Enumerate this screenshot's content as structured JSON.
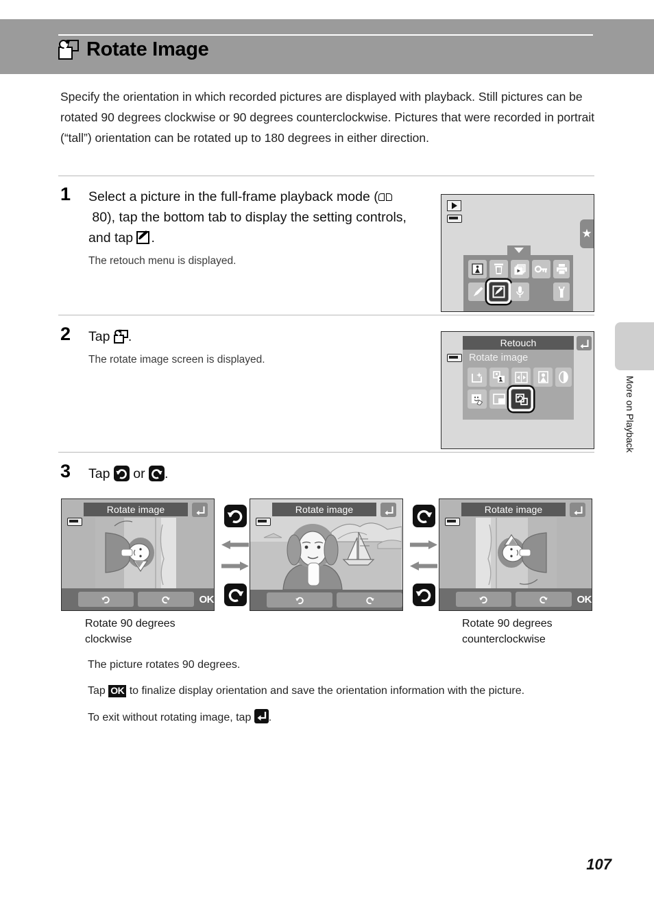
{
  "header": {
    "title": "Rotate Image",
    "icon": "rotate-image-icon"
  },
  "intro": "Specify the orientation in which recorded pictures are displayed with playback. Still pictures can be rotated 90 degrees clockwise or 90 degrees counterclockwise. Pictures that were recorded in portrait (“tall”) orientation can be rotated up to 180 degrees in either direction.",
  "steps": [
    {
      "number": "1",
      "head_part1": "Select a picture in the full-frame playback mode (",
      "head_page_ref": "80",
      "head_part2": "), tap the bottom tab to display the setting controls, and tap ",
      "head_part3": ".",
      "sub": "The retouch menu is displayed."
    },
    {
      "number": "2",
      "head_part1": "Tap ",
      "head_part3": ".",
      "sub": "The rotate image screen is displayed."
    },
    {
      "number": "3",
      "head_part1": "Tap ",
      "head_mid": " or ",
      "head_part3": "."
    }
  ],
  "screen1": {
    "status_play_icon": "playback-mode-icon",
    "battery_icon": "battery-icon",
    "favorites_tab_icon": "star-icon",
    "arrow_icon": "chevron-down-icon",
    "row1_keys": [
      {
        "name": "favorites-key",
        "icon": "person-in-box-icon"
      },
      {
        "name": "delete-key",
        "icon": "trash-icon"
      },
      {
        "name": "slideshow-key",
        "icon": "slideshow-icon"
      },
      {
        "name": "protect-key",
        "icon": "key-icon"
      },
      {
        "name": "print-order-key",
        "icon": "printer-icon"
      }
    ],
    "row2_keys": [
      {
        "name": "quick-edit-key",
        "icon": "pencil-icon"
      },
      {
        "name": "retouch-key",
        "icon": "retouch-pencil-box-icon",
        "selected": true
      },
      {
        "name": "voice-memo-key",
        "icon": "microphone-icon"
      },
      {
        "name": "setup-key",
        "icon": "wrench-icon"
      }
    ]
  },
  "screen2": {
    "title": "Retouch",
    "menu_label": "Rotate image",
    "back_icon": "back-arrow-icon",
    "battery_icon": "battery-icon",
    "row1_keys": [
      {
        "name": "quick-retouch-key",
        "icon": "sparkle-frame-icon"
      },
      {
        "name": "d-lighting-key",
        "icon": "d-lighting-icon"
      },
      {
        "name": "small-picture-key",
        "icon": "resize-icon"
      },
      {
        "name": "skin-softening-key",
        "icon": "portrait-icon"
      },
      {
        "name": "filter-effects-key",
        "icon": "half-circle-icon"
      }
    ],
    "row2_keys": [
      {
        "name": "paint-key",
        "icon": "paint-face-icon"
      },
      {
        "name": "crop-key",
        "icon": "crop-icon"
      },
      {
        "name": "rotate-image-key",
        "icon": "rotate-image-icon",
        "selected": true
      }
    ]
  },
  "screen3": {
    "title": "Rotate image",
    "back_icon": "back-arrow-icon",
    "battery_icon": "battery-icon",
    "clockwise_icon": "rotate-clockwise-icon",
    "counterclockwise_icon": "rotate-counterclockwise-icon",
    "ok_label": "OK",
    "left_caption": "Rotate 90 degrees clockwise",
    "right_caption": "Rotate 90 degrees counterclockwise"
  },
  "tail_notes": {
    "line1": "The picture rotates 90 degrees.",
    "line2_part1": "Tap ",
    "line2_ok": "OK",
    "line2_part2": " to finalize display orientation and save the orientation information with the picture.",
    "line3_part1": "To exit without rotating image, tap ",
    "line3_part2": "."
  },
  "side_tab": {
    "label": "More on Playback"
  },
  "page_number": "107",
  "colors": {
    "header_bg": "#9b9b9b",
    "screen_bg": "#d9d9d9",
    "panel": "#8d8d8d",
    "titlebar": "#595959",
    "key": "#c4c4c4",
    "dark_key": "#3b3b3b",
    "arrow": "#8a8a8a"
  }
}
